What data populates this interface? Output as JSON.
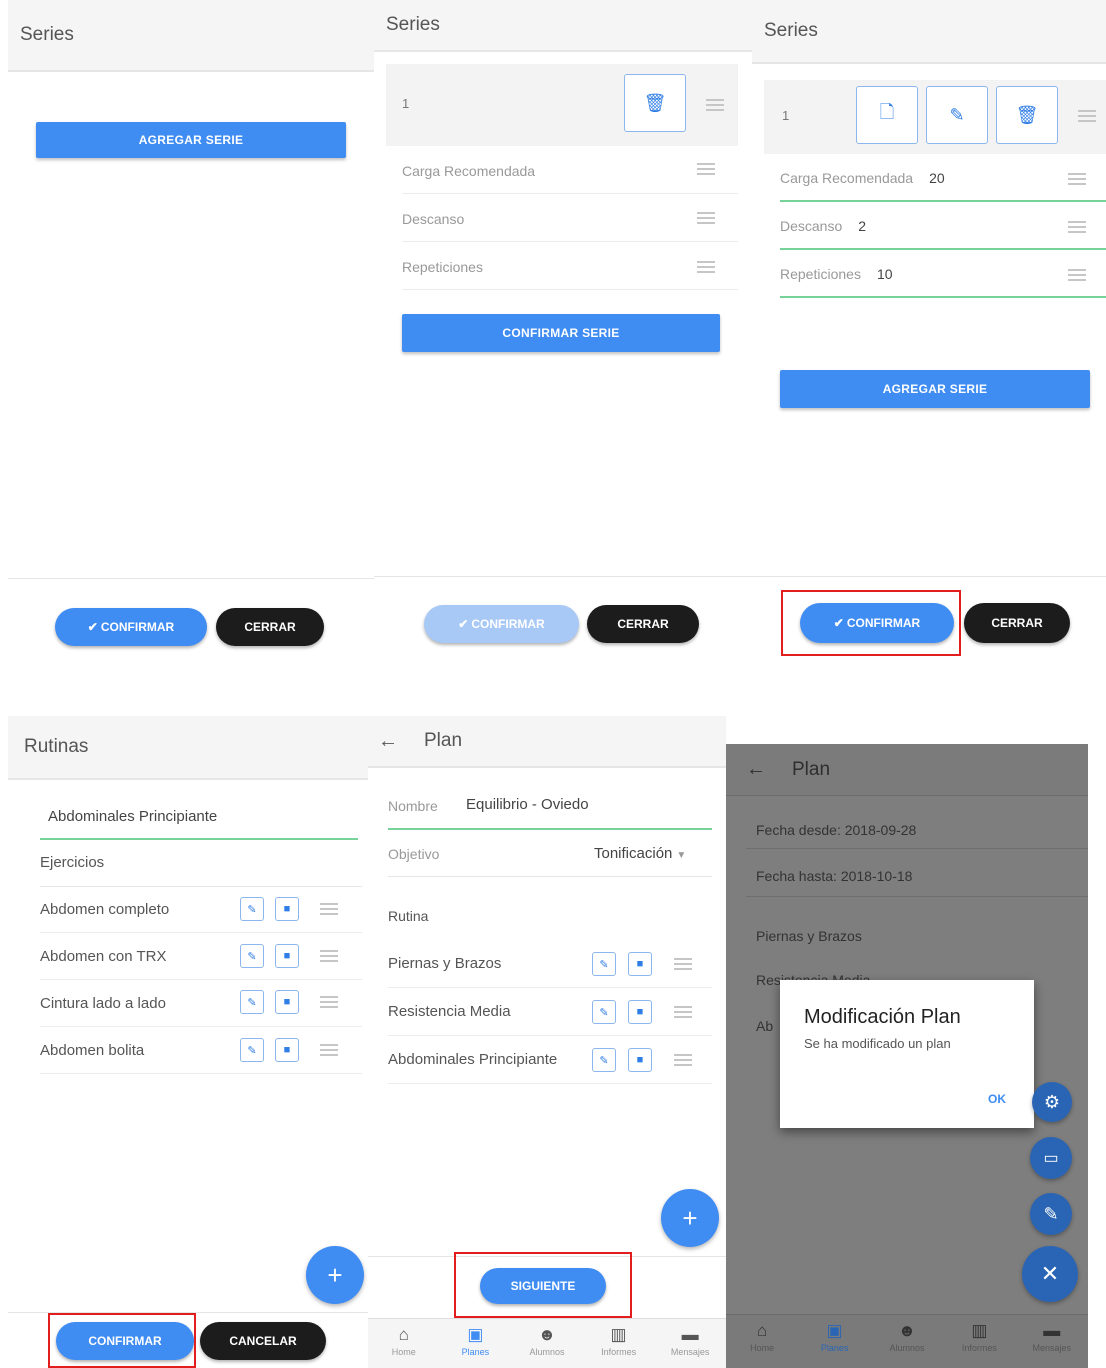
{
  "p1": {
    "title": "Series",
    "add_label": "AGREGAR SERIE",
    "confirm_label": "CONFIRMAR",
    "close_label": "CERRAR"
  },
  "p2": {
    "title": "Series",
    "serie_num": "1",
    "fields": [
      "Carga Recomendada",
      "Descanso",
      "Repeticiones"
    ],
    "confirm_serie_label": "CONFIRMAR SERIE",
    "confirm_label": "CONFIRMAR",
    "close_label": "CERRAR"
  },
  "p3": {
    "title": "Series",
    "serie_num": "1",
    "fields": [
      {
        "label": "Carga Recomendada",
        "value": "20"
      },
      {
        "label": "Descanso",
        "value": "2"
      },
      {
        "label": "Repeticiones",
        "value": "10"
      }
    ],
    "add_label": "AGREGAR SERIE",
    "confirm_label": "CONFIRMAR",
    "close_label": "CERRAR"
  },
  "p4": {
    "title": "Rutinas",
    "rutina_name": "Abdominales Principiante",
    "ejercicios_label": "Ejercicios",
    "ejercicios": [
      "Abdomen completo",
      "Abdomen con TRX",
      "Cintura lado a lado",
      "Abdomen bolita"
    ],
    "confirm_label": "CONFIRMAR",
    "cancel_label": "CANCELAR"
  },
  "p5": {
    "title": "Plan",
    "nombre_label": "Nombre",
    "nombre_value": "Equilibrio - Oviedo",
    "objetivo_label": "Objetivo",
    "objetivo_value": "Tonificación",
    "rutina_label": "Rutina",
    "rutinas": [
      "Piernas y Brazos",
      "Resistencia Media",
      "Abdominales Principiante"
    ],
    "next_label": "SIGUIENTE",
    "nav": [
      "Home",
      "Planes",
      "Alumnos",
      "Informes",
      "Mensajes"
    ]
  },
  "p6": {
    "title": "Plan",
    "fecha_desde": "Fecha desde: 2018-09-28",
    "fecha_hasta": "Fecha hasta: 2018-10-18",
    "bg_items": [
      "Piernas y Brazos",
      "Resistencia Media",
      "Ab"
    ],
    "dialog_title": "Modificación Plan",
    "dialog_msg": "Se ha modificado un plan",
    "dialog_ok": "OK",
    "nav": [
      "Home",
      "Planes",
      "Alumnos",
      "Informes",
      "Mensajes"
    ]
  },
  "colors": {
    "accent": "#3f8cf3",
    "dark_button": "#1c1c1c",
    "highlight": "#e21d1d",
    "valid_underline": "#77d39a"
  }
}
